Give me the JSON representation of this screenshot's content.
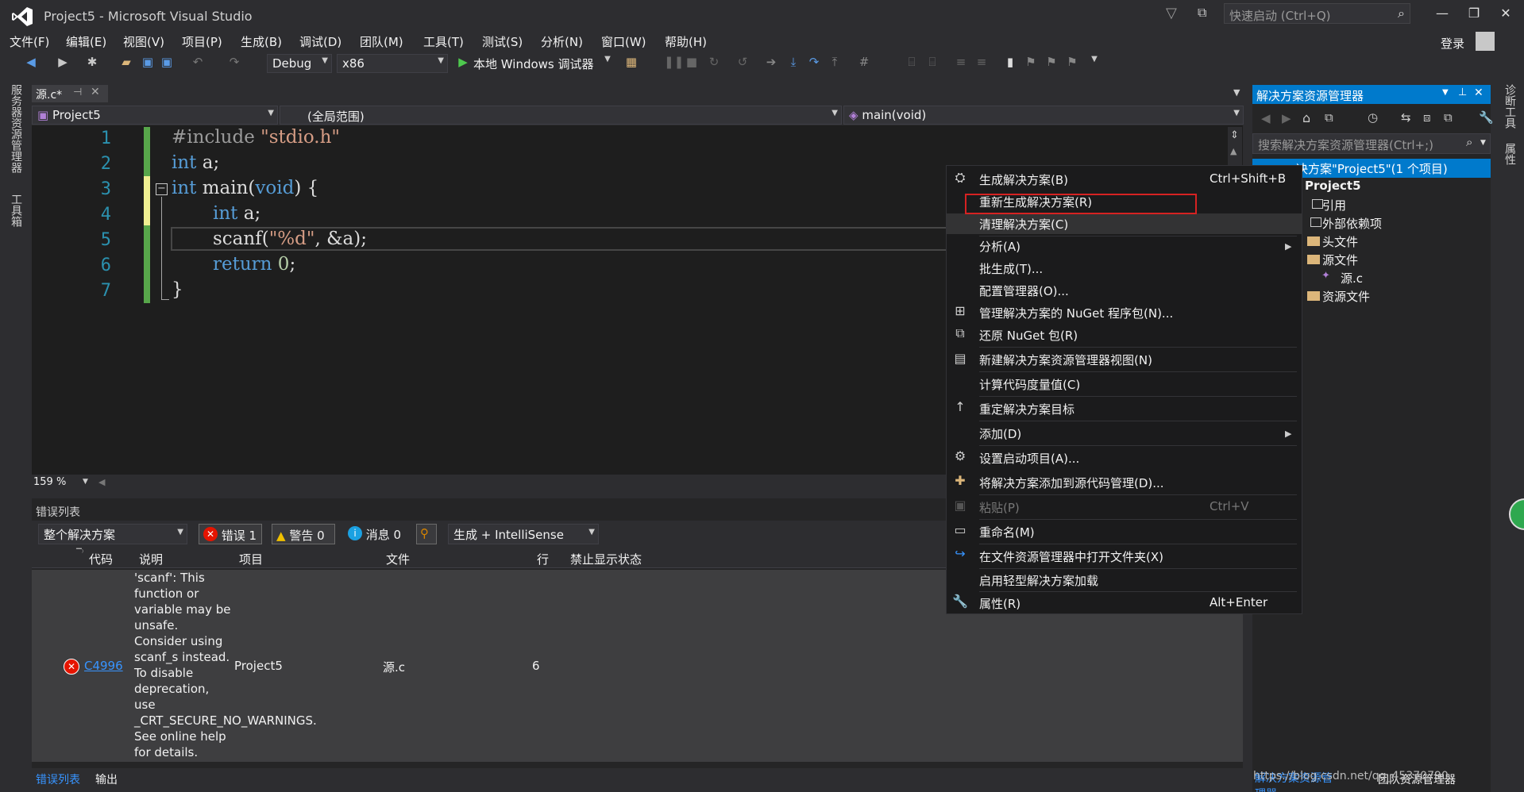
{
  "window": {
    "title": "Project5 - Microsoft Visual Studio",
    "quick_launch_placeholder": "快速启动 (Ctrl+Q)",
    "login": "登录"
  },
  "menu": [
    "文件(F)",
    "编辑(E)",
    "视图(V)",
    "项目(P)",
    "生成(B)",
    "调试(D)",
    "团队(M)",
    "工具(T)",
    "测试(S)",
    "分析(N)",
    "窗口(W)",
    "帮助(H)"
  ],
  "toolbar": {
    "config": "Debug",
    "platform": "x86",
    "debugger": "本地 Windows 调试器"
  },
  "left_strip": {
    "server_explorer": "服务器资源管理器",
    "toolbox": "工具箱"
  },
  "editor": {
    "tab_label": "源.c*",
    "nav_project": "Project5",
    "nav_scope": "(全局范围)",
    "nav_member": "main(void)",
    "zoom": "159 %",
    "line_numbers": [
      "1",
      "2",
      "3",
      "4",
      "5",
      "6",
      "7"
    ],
    "lines": [
      {
        "pp": "#include ",
        "str": "\"stdio.h\""
      },
      {
        "kw": "int",
        "rest": " a;"
      },
      {
        "kw": "int",
        "rest": " main(",
        "kw2": "void",
        "rest2": ") {"
      },
      {
        "kw": "int",
        "rest": " a;"
      },
      {
        "rest": "scanf(",
        "str": "\"%d\"",
        "rest2": ", &a);"
      },
      {
        "kw": "return",
        "num": "0",
        "rest": ";"
      },
      {
        "rest": "}"
      }
    ]
  },
  "error_list": {
    "title": "错误列表",
    "scope": "整个解决方案",
    "errors_btn": "错误 1",
    "warnings_btn": "警告 0",
    "messages_btn": "消息 0",
    "build_filter": "生成 + IntelliSense",
    "columns": [
      "代码",
      "说明",
      "项目",
      "文件",
      "行",
      "禁止显示状态"
    ],
    "rows": [
      {
        "code": "C4996",
        "description": "'scanf': This function or variable may be unsafe. Consider using scanf_s instead. To disable deprecation, use _CRT_SECURE_NO_WARNINGS. See online help for details.",
        "project": "Project5",
        "file": "源.c",
        "line": "6",
        "suppression": ""
      }
    ],
    "bottom_tabs": [
      "错误列表",
      "输出"
    ]
  },
  "solution_explorer": {
    "title": "解决方案资源管理器",
    "search_placeholder": "搜索解决方案资源管理器(Ctrl+;)",
    "solution": "决方案\"Project5\"(1 个项目)",
    "project": "Project5",
    "items": [
      "引用",
      "外部依赖项",
      "头文件",
      "源文件",
      "源.c",
      "资源文件"
    ],
    "bottom_tab": "团队资源管理器"
  },
  "right_strip": {
    "diag": "诊断工具",
    "props": "属性"
  },
  "context_menu": {
    "items": [
      {
        "label": "生成解决方案(B)",
        "shortcut": "Ctrl+Shift+B"
      },
      {
        "label": "重新生成解决方案(R)"
      },
      {
        "label": "清理解决方案(C)"
      },
      {
        "label": "分析(A)"
      },
      {
        "label": "批生成(T)..."
      },
      {
        "label": "配置管理器(O)..."
      },
      {
        "label": "管理解决方案的 NuGet 程序包(N)..."
      },
      {
        "label": "还原 NuGet 包(R)"
      },
      {
        "label": "新建解决方案资源管理器视图(N)"
      },
      {
        "label": "计算代码度量值(C)"
      },
      {
        "label": "重定解决方案目标"
      },
      {
        "label": "添加(D)"
      },
      {
        "label": "设置启动项目(A)..."
      },
      {
        "label": "将解决方案添加到源代码管理(D)..."
      },
      {
        "label": "粘贴(P)",
        "shortcut": "Ctrl+V"
      },
      {
        "label": "重命名(M)"
      },
      {
        "label": "在文件资源管理器中打开文件夹(X)"
      },
      {
        "label": "启用轻型解决方案加载"
      },
      {
        "label": "属性(R)",
        "shortcut": "Alt+Enter"
      }
    ]
  },
  "watermark": "https://blog.csdn.net/qq_45370790",
  "colors": {
    "accent": "#007acc",
    "highlight_box": "#d62222",
    "error_red": "#e51400"
  }
}
